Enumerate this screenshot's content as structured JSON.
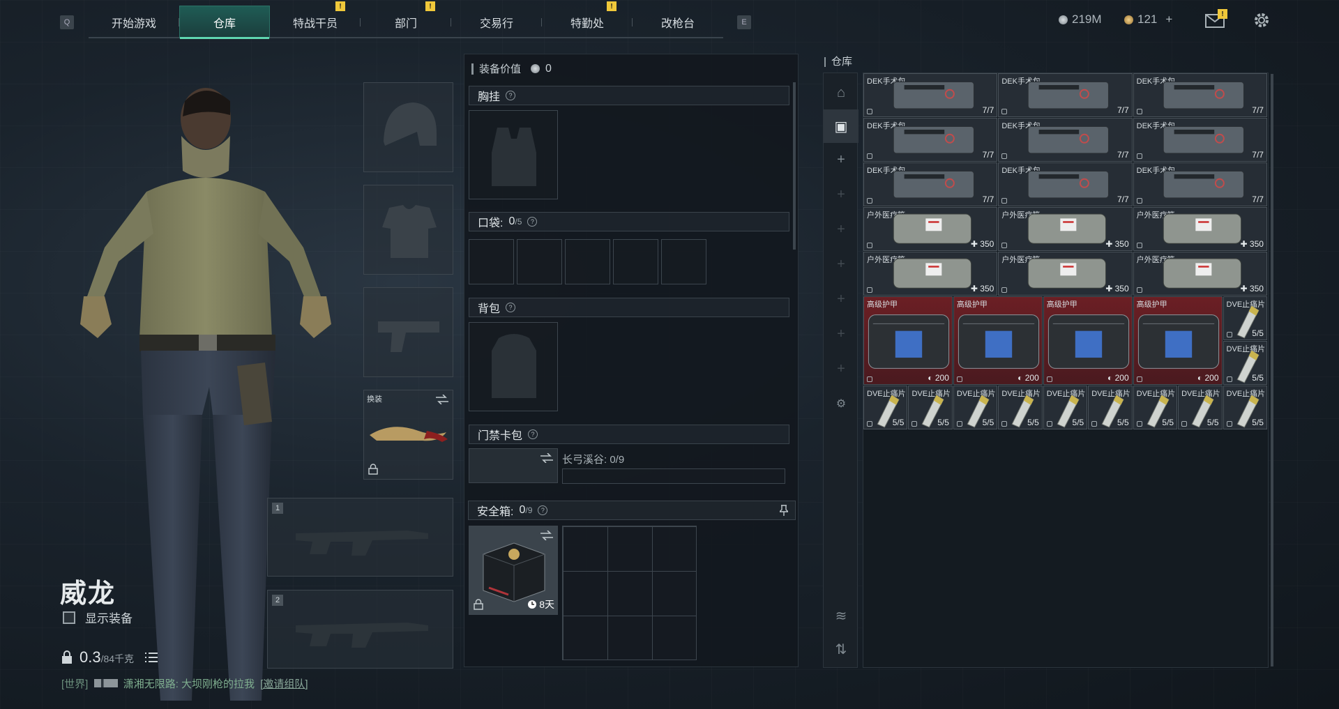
{
  "nav": {
    "left_key": "Q",
    "right_key": "E",
    "tabs": [
      {
        "label": "开始游戏",
        "active": false,
        "badge": ""
      },
      {
        "label": "仓库",
        "active": true,
        "badge": ""
      },
      {
        "label": "特战干员",
        "active": false,
        "badge": "!"
      },
      {
        "label": "部门",
        "active": false,
        "badge": "!"
      },
      {
        "label": "交易行",
        "active": false,
        "badge": ""
      },
      {
        "label": "特勤处",
        "active": false,
        "badge": "!"
      },
      {
        "label": "改枪台",
        "active": false,
        "badge": ""
      }
    ]
  },
  "currency": {
    "silver": "219M",
    "gold": "121",
    "add": "+",
    "mail_badge": "!"
  },
  "character": {
    "name": "威龙",
    "show_equipment_label": "显示装备",
    "weight_value": "0.3",
    "weight_max": "/84千克"
  },
  "chat": {
    "channel": "[世界]",
    "message": "潇湘无限路: 大坝刚枪的拉我",
    "invite": "[邀请组队]"
  },
  "equipment_slots": {
    "melee_label": "换装",
    "primary_num": "1",
    "secondary_num": "2"
  },
  "loadout": {
    "value_label": "装备价值",
    "value": "0",
    "chest_rig": "胸挂",
    "pockets_label": "口袋:",
    "pockets_value": "0",
    "pockets_max": "/5",
    "backpack": "背包",
    "keycard": "门禁卡包",
    "keycard_map": "长弓溪谷: 0/9",
    "safebox_label": "安全箱:",
    "safebox_value": "0",
    "safebox_max": "/9",
    "safebox_time": "8天"
  },
  "warehouse": {
    "title": "仓库",
    "items_surgical": [
      {
        "name": "DEK手术包",
        "count": "7/7"
      },
      {
        "name": "DEK手术包",
        "count": "7/7"
      },
      {
        "name": "DEK手术包",
        "count": "7/7"
      },
      {
        "name": "DEK手术包",
        "count": "7/7"
      },
      {
        "name": "DEK手术包",
        "count": "7/7"
      },
      {
        "name": "DEK手术包",
        "count": "7/7"
      },
      {
        "name": "DEK手术包",
        "count": "7/7"
      },
      {
        "name": "DEK手术包",
        "count": "7/7"
      },
      {
        "name": "DEK手术包",
        "count": "7/7"
      }
    ],
    "items_medkit": [
      {
        "name": "户外医疗箱",
        "count": "350"
      },
      {
        "name": "户外医疗箱",
        "count": "350"
      },
      {
        "name": "户外医疗箱",
        "count": "350"
      },
      {
        "name": "户外医疗箱",
        "count": "350"
      },
      {
        "name": "户外医疗箱",
        "count": "350"
      },
      {
        "name": "户外医疗箱",
        "count": "350"
      }
    ],
    "items_armor": [
      {
        "name": "高级护甲",
        "count": "200"
      },
      {
        "name": "高级护甲",
        "count": "200"
      },
      {
        "name": "高级护甲",
        "count": "200"
      },
      {
        "name": "高级护甲",
        "count": "200"
      }
    ],
    "items_painkiller": [
      {
        "name": "DVE止痛片",
        "count": "5/5"
      },
      {
        "name": "DVE止痛片",
        "count": "5/5"
      },
      {
        "name": "DVE止痛片",
        "count": "5/5"
      },
      {
        "name": "DVE止痛片",
        "count": "5/5"
      },
      {
        "name": "DVE止痛片",
        "count": "5/5"
      },
      {
        "name": "DVE止痛片",
        "count": "5/5"
      },
      {
        "name": "DVE止痛片",
        "count": "5/5"
      },
      {
        "name": "DVE止痛片",
        "count": "5/5"
      },
      {
        "name": "DVE止痛片",
        "count": "5/5"
      },
      {
        "name": "DVE止痛片",
        "count": "5/5"
      },
      {
        "name": "DVE止痛片",
        "count": "5/5"
      }
    ]
  }
}
